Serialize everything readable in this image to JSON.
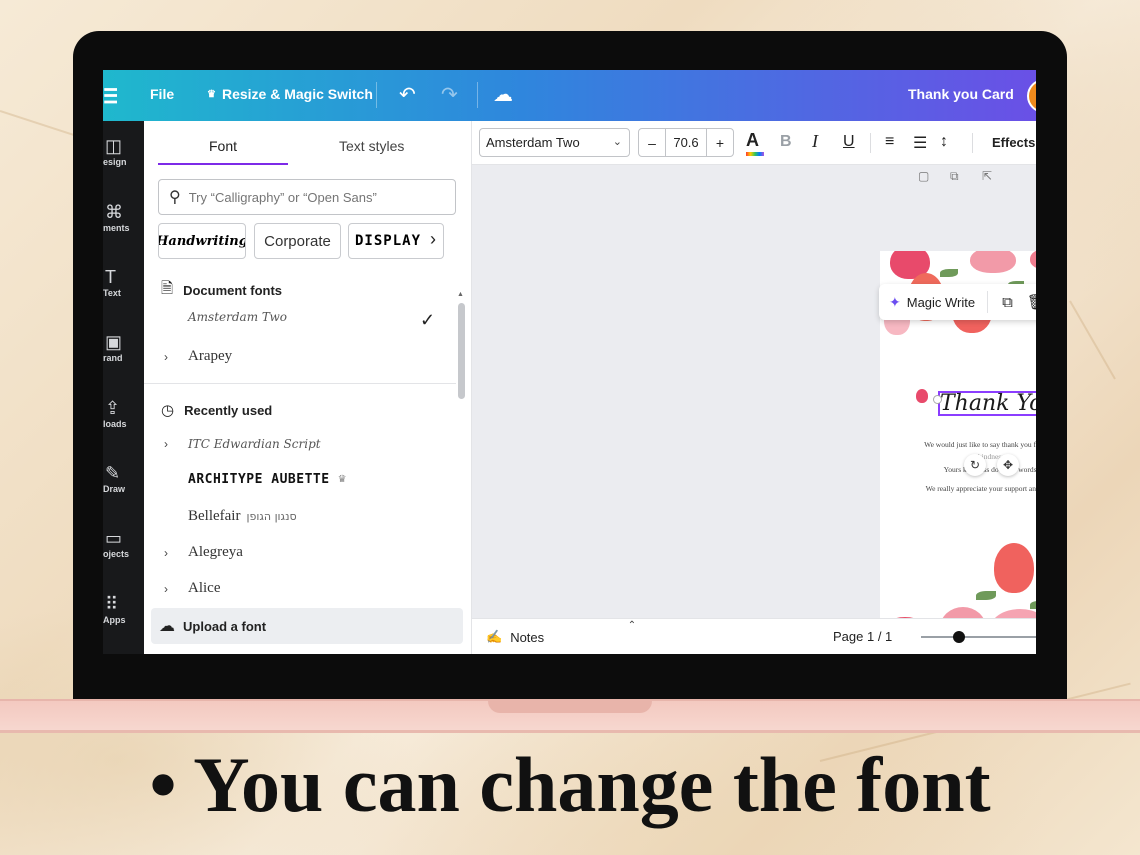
{
  "topbar": {
    "menu_icon": "☰",
    "file": "File",
    "resize": "Resize & Magic Switch",
    "crown_icon": "♛",
    "undo_icon": "↶",
    "redo_icon": "↷",
    "cloud_icon": "☁",
    "title": "Thank you Card"
  },
  "rail": [
    {
      "icon": "◫",
      "label": "esign"
    },
    {
      "icon": "⌘",
      "label": "ments"
    },
    {
      "icon": "T",
      "label": "Text"
    },
    {
      "icon": "▣",
      "label": "rand"
    },
    {
      "icon": "⇪",
      "label": "loads"
    },
    {
      "icon": "✎",
      "label": "Draw"
    },
    {
      "icon": "▭",
      "label": "ojects"
    },
    {
      "icon": "⠿",
      "label": "Apps"
    }
  ],
  "panel": {
    "tab_font": "Font",
    "tab_styles": "Text styles",
    "search_placeholder": "Try “Calligraphy” or “Open Sans”",
    "chips": [
      "Handwriting",
      "Corporate",
      "DISPLAY"
    ],
    "chip_arrow": "›",
    "doc_fonts_heading": "Document fonts",
    "doc_fonts": [
      "Amsterdam Two",
      "Arapey"
    ],
    "check_icon": "✓",
    "recent_heading": "Recently used",
    "recent_fonts": [
      "ITC Edwardian Script",
      "ARCHITYPE AUBETTE",
      "Bellefair",
      "Alegreya",
      "Alice"
    ],
    "bellefair_hebrew": "סנגון הגופן",
    "upload_label": "Upload a font"
  },
  "toolbar": {
    "font_name": "Amsterdam Two",
    "size_minus": "–",
    "size_value": "70.6",
    "size_plus": "+",
    "text_color": "A",
    "bold": "B",
    "italic": "I",
    "underline": "U",
    "align_icon": "≡",
    "list_icon": "☰",
    "spacing_icon": "↕",
    "effects": "Effects"
  },
  "context_bar": {
    "magic_write": "Magic Write",
    "wand_icon": "✦",
    "duplicate_icon": "⧉",
    "delete_icon": "🗑",
    "more_icon": "•••"
  },
  "card": {
    "heading": "Thank You",
    "lines": [
      "We would just like to say thank you for your",
      "kindness",
      "Yours kindness does tell words.",
      "We really appreciate your support and love."
    ],
    "rotate_icon": "↻",
    "move_icon": "✥"
  },
  "footer": {
    "notes": "Notes",
    "notes_icon": "✍",
    "page": "Page 1 / 1",
    "expand_icon": "⌃"
  },
  "caption": "• You can change the font",
  "colors": {
    "accent": "#7d2ae8",
    "topbar_start": "#1fb8cd",
    "topbar_end": "#6a50e6",
    "flower_pink": "#e84a6b"
  }
}
